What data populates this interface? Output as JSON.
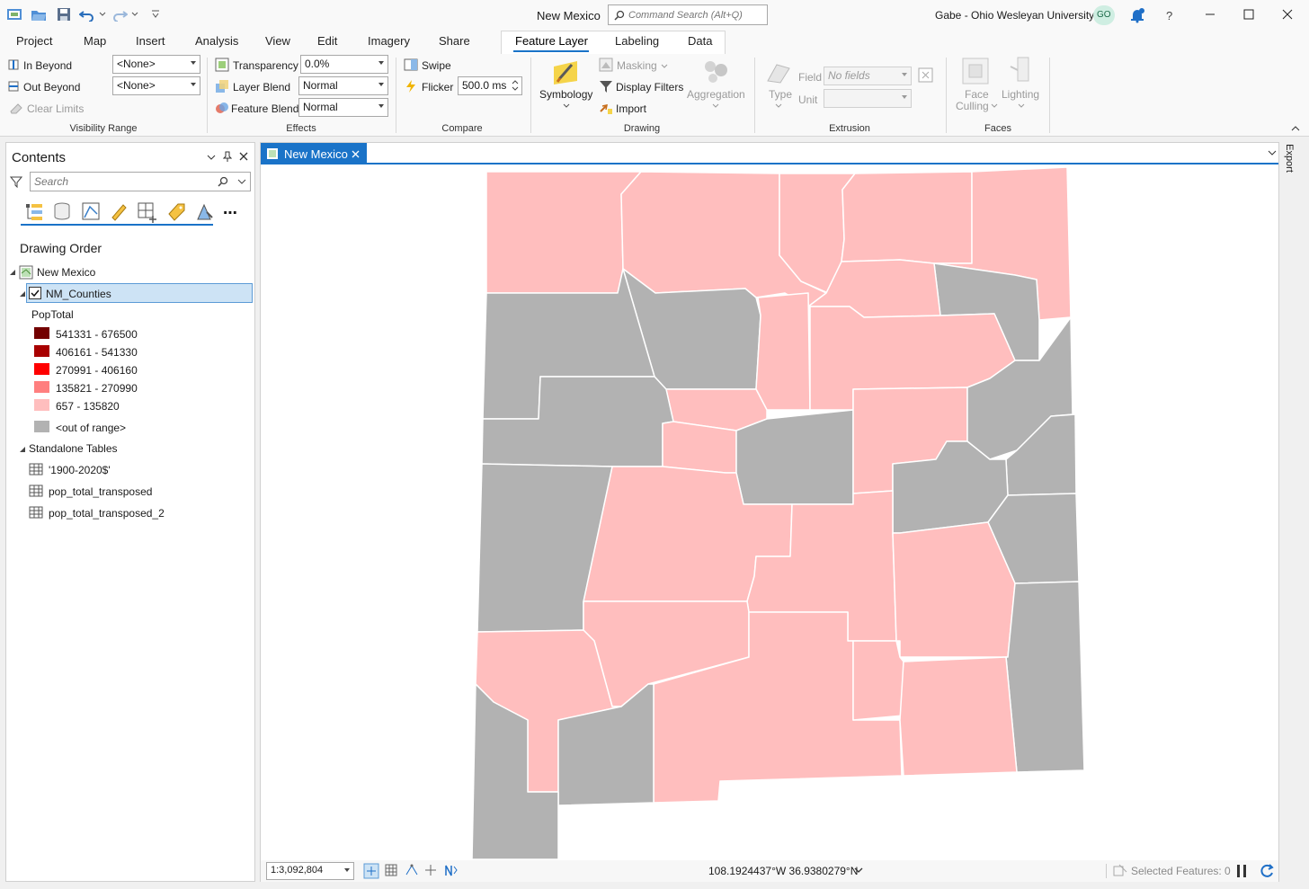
{
  "titlebar": {
    "project_title": "New Mexico",
    "command_search_placeholder": "Command Search (Alt+Q)",
    "user": "Gabe - Ohio Wesleyan University",
    "user_initials": "GO",
    "help": "?"
  },
  "ribbon_tabs": [
    "Project",
    "Map",
    "Insert",
    "Analysis",
    "View",
    "Edit",
    "Imagery",
    "Share",
    "Feature Layer",
    "Labeling",
    "Data"
  ],
  "ribbon": {
    "visibility_range": {
      "in_beyond": "In Beyond",
      "in_beyond_value": "<None>",
      "out_beyond": "Out Beyond",
      "out_beyond_value": "<None>",
      "clear_limits": "Clear Limits",
      "group": "Visibility Range"
    },
    "effects": {
      "transparency": "Transparency",
      "transparency_value": "0.0%",
      "layer_blend": "Layer Blend",
      "layer_blend_value": "Normal",
      "feature_blend": "Feature Blend",
      "feature_blend_value": "Normal",
      "group": "Effects"
    },
    "compare": {
      "swipe": "Swipe",
      "flicker": "Flicker",
      "flicker_value": "500.0  ms",
      "group": "Compare"
    },
    "drawing": {
      "symbology": "Symbology",
      "masking": "Masking",
      "display_filters": "Display Filters",
      "import": "Import",
      "aggregation": "Aggregation",
      "group": "Drawing"
    },
    "extrusion": {
      "type": "Type",
      "field": "Field",
      "field_value": "No fields",
      "unit": "Unit",
      "group": "Extrusion"
    },
    "faces": {
      "face": "Face",
      "culling": "Culling",
      "lighting": "Lighting",
      "group": "Faces"
    }
  },
  "contents": {
    "title": "Contents",
    "search_placeholder": "Search",
    "drawing_order": "Drawing Order",
    "map_name": "New Mexico",
    "layer_name": "NM_Counties",
    "field_name": "PopTotal",
    "legend": [
      {
        "label": "541331 - 676500",
        "color": "#730000"
      },
      {
        "label": "406161 - 541330",
        "color": "#a80000"
      },
      {
        "label": "270991 - 406160",
        "color": "#ff0000"
      },
      {
        "label": "135821 - 270990",
        "color": "#ff7f7f"
      },
      {
        "label": "657 - 135820",
        "color": "#ffbebe"
      }
    ],
    "out_of_range": {
      "label": "<out of range>",
      "color": "#b2b2b2"
    },
    "standalone_tables": "Standalone Tables",
    "tables": [
      "'1900-2020$'",
      "pop_total_transposed",
      "pop_total_transposed_2"
    ]
  },
  "map": {
    "tab_title": "New Mexico",
    "scale": "1:3,092,804",
    "coordinates": "108.1924437°W 36.9380279°N",
    "selected_features": "Selected Features: 0",
    "fill_in_range": "#ffbebe",
    "fill_out_of_range": "#b2b2b2",
    "stroke": "#ffffff"
  },
  "right_panel": {
    "export_label": "Export"
  }
}
